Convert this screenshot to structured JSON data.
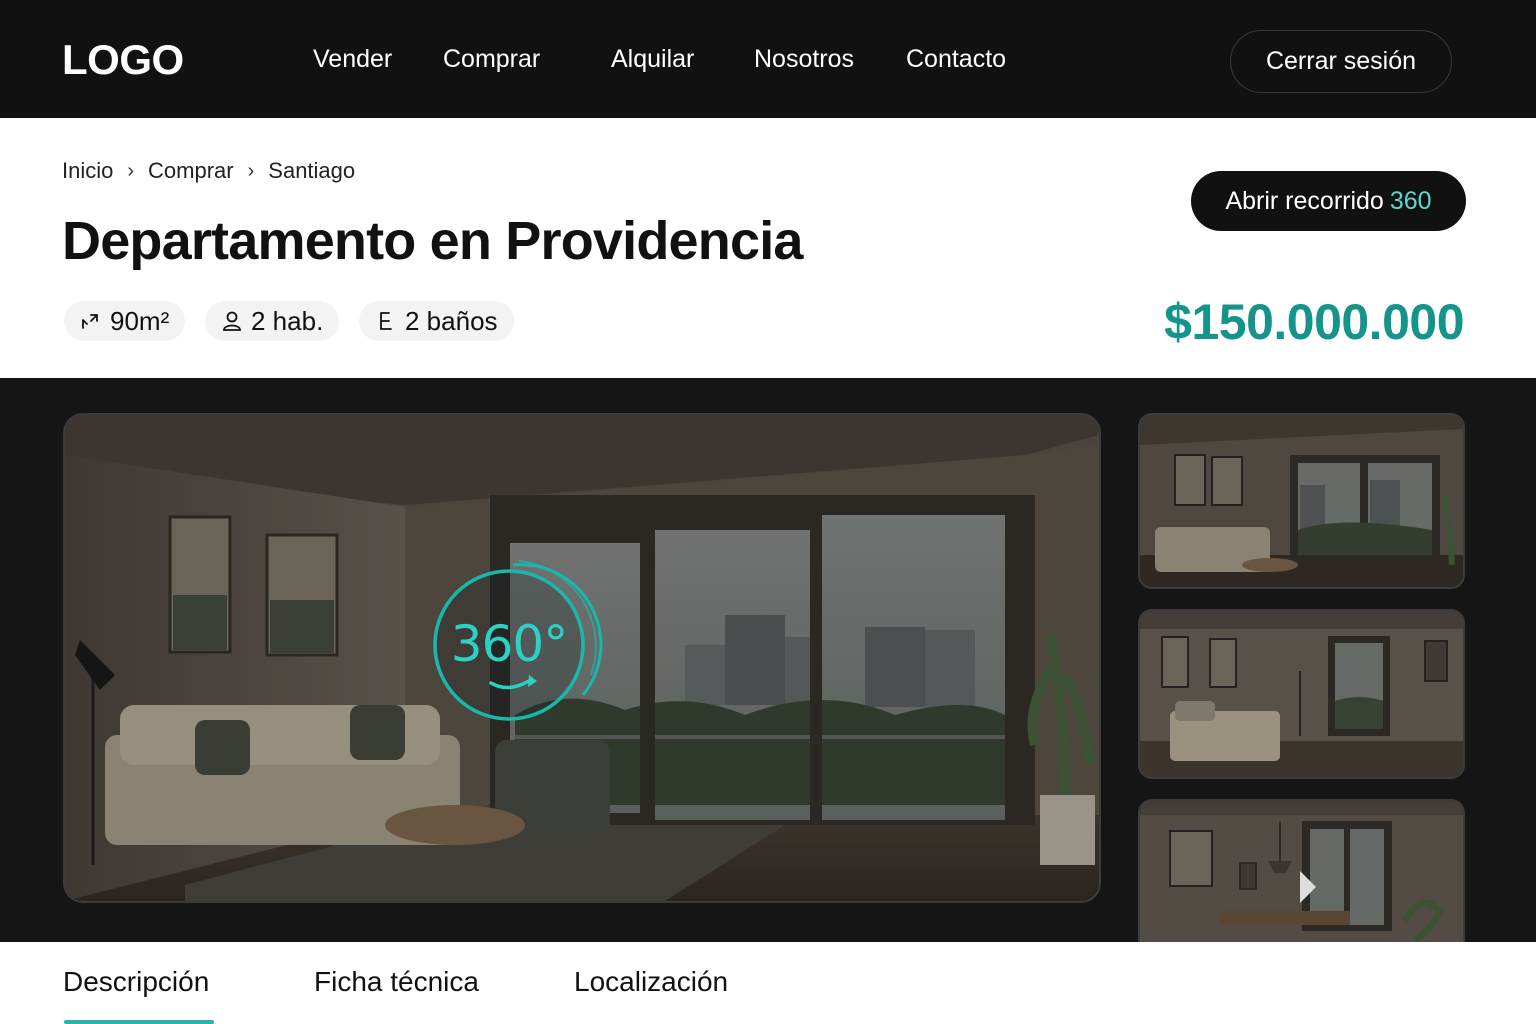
{
  "header": {
    "logo": "LOGO",
    "nav": [
      {
        "label": "Vender"
      },
      {
        "label": "Comprar"
      },
      {
        "label": "Alquilar"
      },
      {
        "label": "Nosotros"
      },
      {
        "label": "Contacto"
      }
    ],
    "logout_label": "Cerrar sesión"
  },
  "breadcrumb": [
    "Inicio",
    "Comprar",
    "Santiago"
  ],
  "listing": {
    "title": "Departamento en Providencia",
    "tour_label": "Abrir recorrido",
    "tour_accent": "360",
    "features": {
      "area": "90m²",
      "rooms": "2 hab.",
      "baths": "2 baños"
    },
    "price": "$150.000.000"
  },
  "gallery": {
    "badge": "360°",
    "icons": [
      "360-badge-icon",
      "play-arrow-icon"
    ]
  },
  "tabs": [
    {
      "label": "Descripción",
      "active": true
    },
    {
      "label": "Ficha técnica",
      "active": false
    },
    {
      "label": "Localización",
      "active": false
    }
  ],
  "colors": {
    "accent": "#15958a",
    "accent_light": "#2ad1c4",
    "dark": "#111111"
  }
}
